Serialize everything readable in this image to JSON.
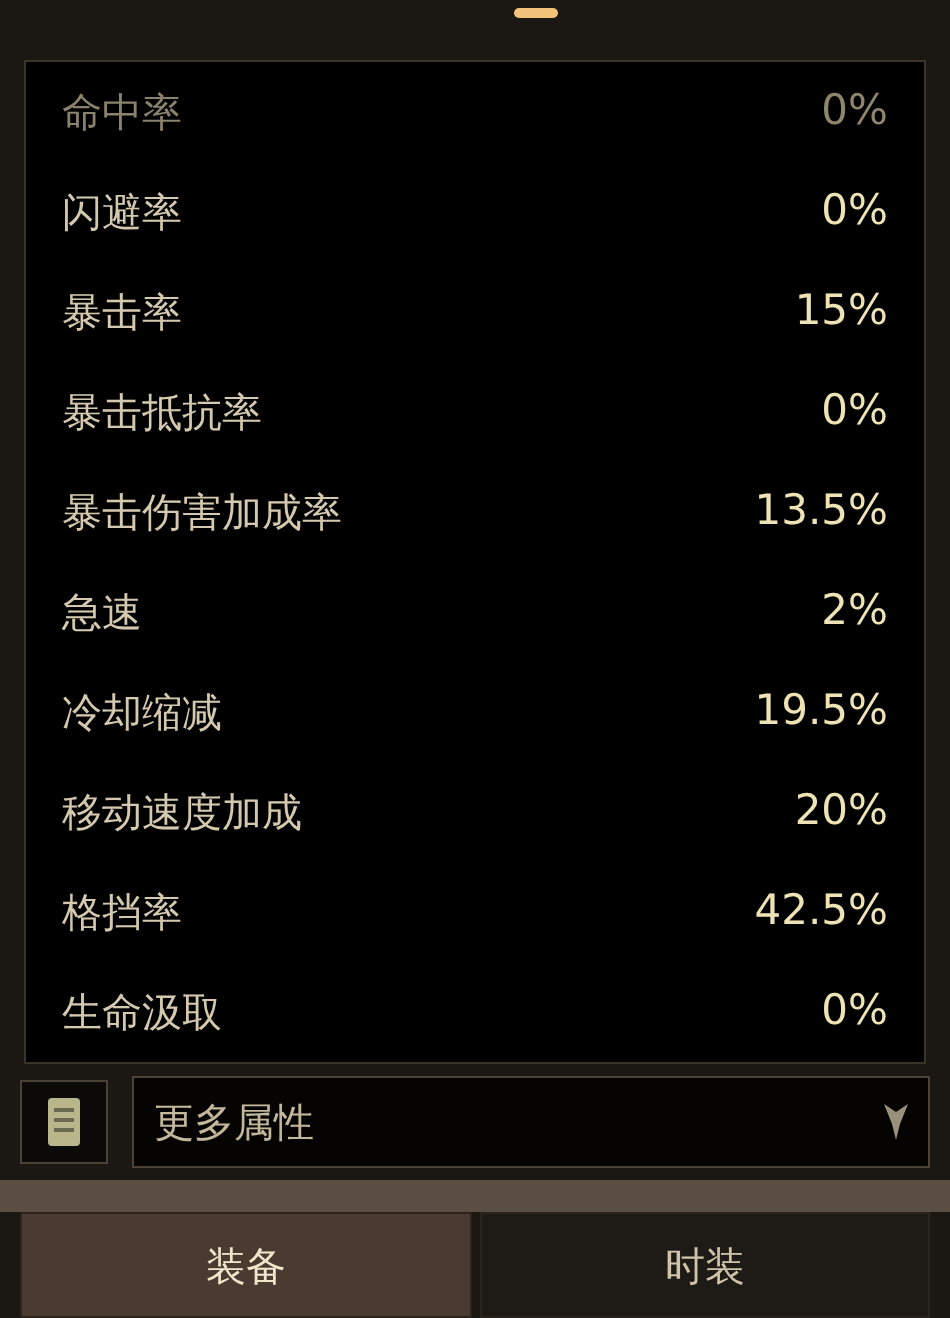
{
  "stats": [
    {
      "name": "命中率",
      "value": "0%",
      "dimmed": true
    },
    {
      "name": "闪避率",
      "value": "0%",
      "dimmed": false
    },
    {
      "name": "暴击率",
      "value": "15%",
      "dimmed": false
    },
    {
      "name": "暴击抵抗率",
      "value": "0%",
      "dimmed": false
    },
    {
      "name": "暴击伤害加成率",
      "value": "13.5%",
      "dimmed": false
    },
    {
      "name": "急速",
      "value": "2%",
      "dimmed": false
    },
    {
      "name": "冷却缩减",
      "value": "19.5%",
      "dimmed": false
    },
    {
      "name": "移动速度加成",
      "value": "20%",
      "dimmed": false
    },
    {
      "name": "格挡率",
      "value": "42.5%",
      "dimmed": false
    },
    {
      "name": "生命汲取",
      "value": "0%",
      "dimmed": false
    }
  ],
  "dropdown": {
    "label": "更多属性"
  },
  "tabs": [
    {
      "label": "装备",
      "selected": true
    },
    {
      "label": "时装",
      "selected": false
    }
  ]
}
